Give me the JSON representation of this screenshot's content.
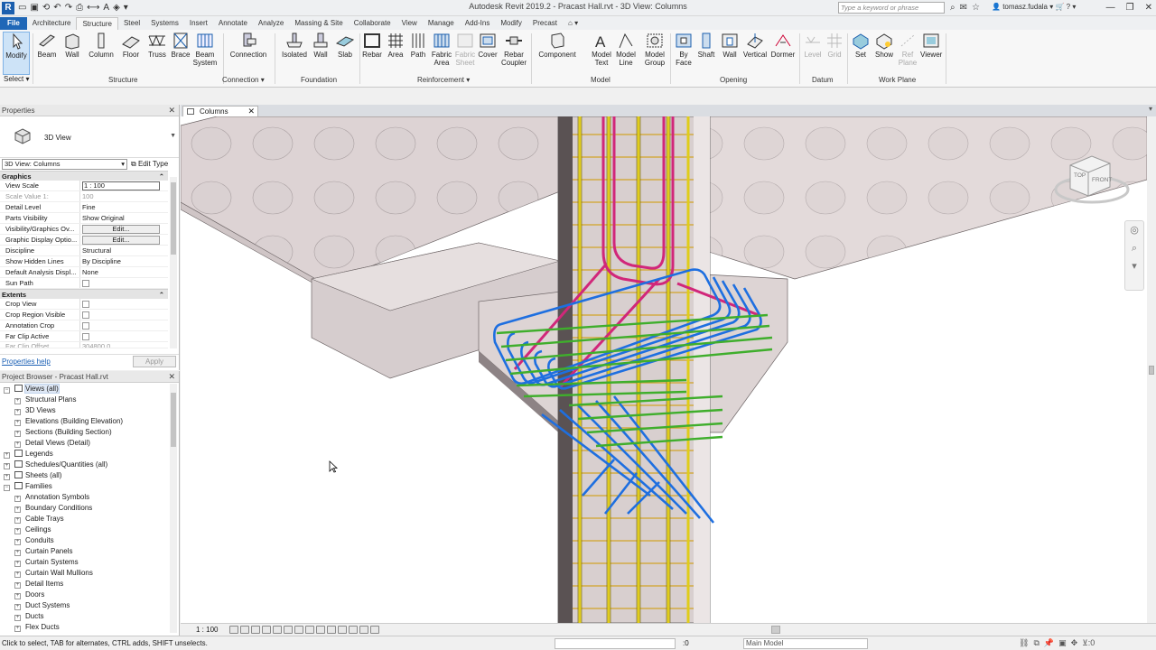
{
  "app": {
    "title": "Autodesk Revit 2019.2 - Pracast Hall.rvt - 3D View: Columns",
    "search_placeholder": "Type a keyword or phrase",
    "user": "tomasz.fudala"
  },
  "tabs": [
    "File",
    "Architecture",
    "Structure",
    "Steel",
    "Systems",
    "Insert",
    "Annotate",
    "Analyze",
    "Massing & Site",
    "Collaborate",
    "View",
    "Manage",
    "Add-Ins",
    "Modify",
    "Precast"
  ],
  "ribbon": {
    "modify": "Modify",
    "select": "Select",
    "structure": {
      "label": "Structure",
      "buttons": [
        "Beam",
        "Wall",
        "Column",
        "Floor",
        "Truss",
        "Brace"
      ],
      "beam_system": "Beam System"
    },
    "connection": {
      "label": "Connection",
      "button": "Connection"
    },
    "foundation": {
      "label": "Foundation",
      "buttons": [
        "Isolated",
        "Wall",
        "Slab"
      ]
    },
    "reinforcement": {
      "label": "Reinforcement",
      "buttons": [
        "Rebar",
        "Area",
        "Path",
        "Fabric Area",
        "Fabric Sheet",
        "Cover",
        "Rebar Coupler"
      ]
    },
    "model": {
      "label": "Model",
      "buttons": [
        "Component",
        "Model Text",
        "Model Line",
        "Model Group"
      ]
    },
    "opening": {
      "label": "Opening",
      "buttons": [
        "By Face",
        "Shaft",
        "Wall",
        "Vertical",
        "Dormer"
      ]
    },
    "datum": {
      "label": "Datum",
      "buttons": [
        "Level",
        "Grid"
      ]
    },
    "workplane": {
      "label": "Work Plane",
      "buttons": [
        "Set",
        "Show",
        "Ref Plane",
        "Viewer"
      ]
    }
  },
  "properties": {
    "title": "Properties",
    "type_name": "3D View",
    "instance": "3D View: Columns",
    "edit_type": "Edit Type",
    "graphics_header": "Graphics",
    "graphics": [
      {
        "k": "View Scale",
        "v": "1 : 100"
      },
      {
        "k": "Scale Value    1:",
        "v": "100"
      },
      {
        "k": "Detail Level",
        "v": "Fine"
      },
      {
        "k": "Parts Visibility",
        "v": "Show Original"
      },
      {
        "k": "Visibility/Graphics Ov...",
        "v": "Edit..."
      },
      {
        "k": "Graphic Display Optio...",
        "v": "Edit..."
      },
      {
        "k": "Discipline",
        "v": "Structural"
      },
      {
        "k": "Show Hidden Lines",
        "v": "By Discipline"
      },
      {
        "k": "Default Analysis Displ...",
        "v": "None"
      },
      {
        "k": "Sun Path",
        "v": ""
      }
    ],
    "extents_header": "Extents",
    "extents": [
      {
        "k": "Crop View"
      },
      {
        "k": "Crop Region Visible"
      },
      {
        "k": "Annotation Crop"
      },
      {
        "k": "Far Clip Active"
      },
      {
        "k": "Far Clip Offset",
        "v": "304800.0"
      }
    ],
    "help": "Properties help",
    "apply": "Apply"
  },
  "browser": {
    "title": "Project Browser - Pracast Hall.rvt",
    "nodes": [
      {
        "label": "Views (all)",
        "level": 0
      },
      {
        "label": "Structural Plans",
        "level": 1
      },
      {
        "label": "3D Views",
        "level": 1
      },
      {
        "label": "Elevations (Building Elevation)",
        "level": 1
      },
      {
        "label": "Sections (Building Section)",
        "level": 1
      },
      {
        "label": "Detail Views (Detail)",
        "level": 1
      },
      {
        "label": "Legends",
        "level": 0
      },
      {
        "label": "Schedules/Quantities (all)",
        "level": 0
      },
      {
        "label": "Sheets (all)",
        "level": 0
      },
      {
        "label": "Families",
        "level": 0
      },
      {
        "label": "Annotation Symbols",
        "level": 1
      },
      {
        "label": "Boundary Conditions",
        "level": 1
      },
      {
        "label": "Cable Trays",
        "level": 1
      },
      {
        "label": "Ceilings",
        "level": 1
      },
      {
        "label": "Conduits",
        "level": 1
      },
      {
        "label": "Curtain Panels",
        "level": 1
      },
      {
        "label": "Curtain Systems",
        "level": 1
      },
      {
        "label": "Curtain Wall Mullions",
        "level": 1
      },
      {
        "label": "Detail Items",
        "level": 1
      },
      {
        "label": "Doors",
        "level": 1
      },
      {
        "label": "Duct Systems",
        "level": 1
      },
      {
        "label": "Ducts",
        "level": 1
      },
      {
        "label": "Flex Ducts",
        "level": 1
      }
    ]
  },
  "view": {
    "tab": "Columns",
    "scale": "1 : 100",
    "viewcube": {
      "top": "TOP",
      "front": "FRONT"
    }
  },
  "status": {
    "message": "Click to select, TAB for alternates, CTRL adds, SHIFT unselects.",
    "count": ":0",
    "model": "Main Model"
  }
}
